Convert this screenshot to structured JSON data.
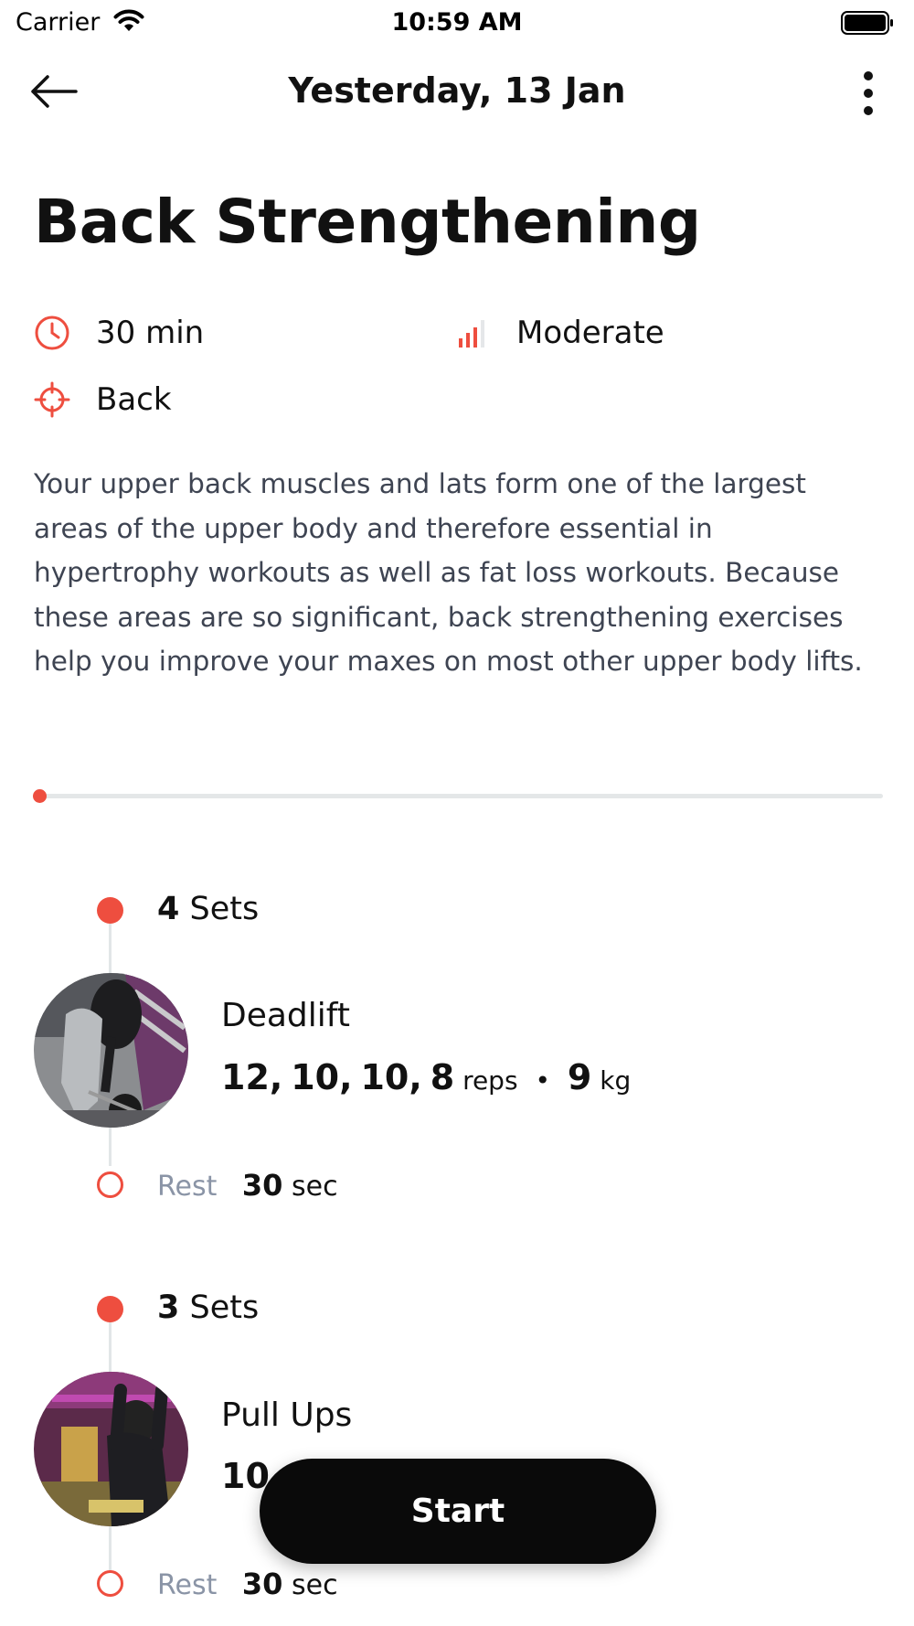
{
  "status_bar": {
    "carrier": "Carrier",
    "time": "10:59 AM"
  },
  "nav": {
    "title": "Yesterday, 13 Jan",
    "back_icon": "arrow-left-icon",
    "more_icon": "more-vertical-icon"
  },
  "workout": {
    "title": "Back Strengthening",
    "duration": "30 min",
    "difficulty": "Moderate",
    "target": "Back",
    "description": "Your upper back muscles and lats form one of the largest areas of the upper body and therefore essential in hypertrophy workouts as well as fat loss workouts. Because these areas are so significant, back strengthening exercises help you improve your maxes on most other upper body lifts.",
    "progress": 0
  },
  "exercises": [
    {
      "sets_count": "4",
      "sets_label": "Sets",
      "name": "Deadlift",
      "reps": [
        "12",
        "10",
        "10",
        "8"
      ],
      "reps_unit": "reps",
      "weight": "9",
      "weight_unit": "kg",
      "rest_label": "Rest",
      "rest_value": "30",
      "rest_unit": "sec"
    },
    {
      "sets_count": "3",
      "sets_label": "Sets",
      "name": "Pull Ups",
      "reps_partial": "10",
      "rest_label": "Rest",
      "rest_value": "30",
      "rest_unit": "sec"
    }
  ],
  "start_button": {
    "label": "Start"
  },
  "colors": {
    "accent": "#ee4e3f",
    "text": "#111111",
    "muted": "#8a94a6",
    "body_text": "#3e4452"
  }
}
